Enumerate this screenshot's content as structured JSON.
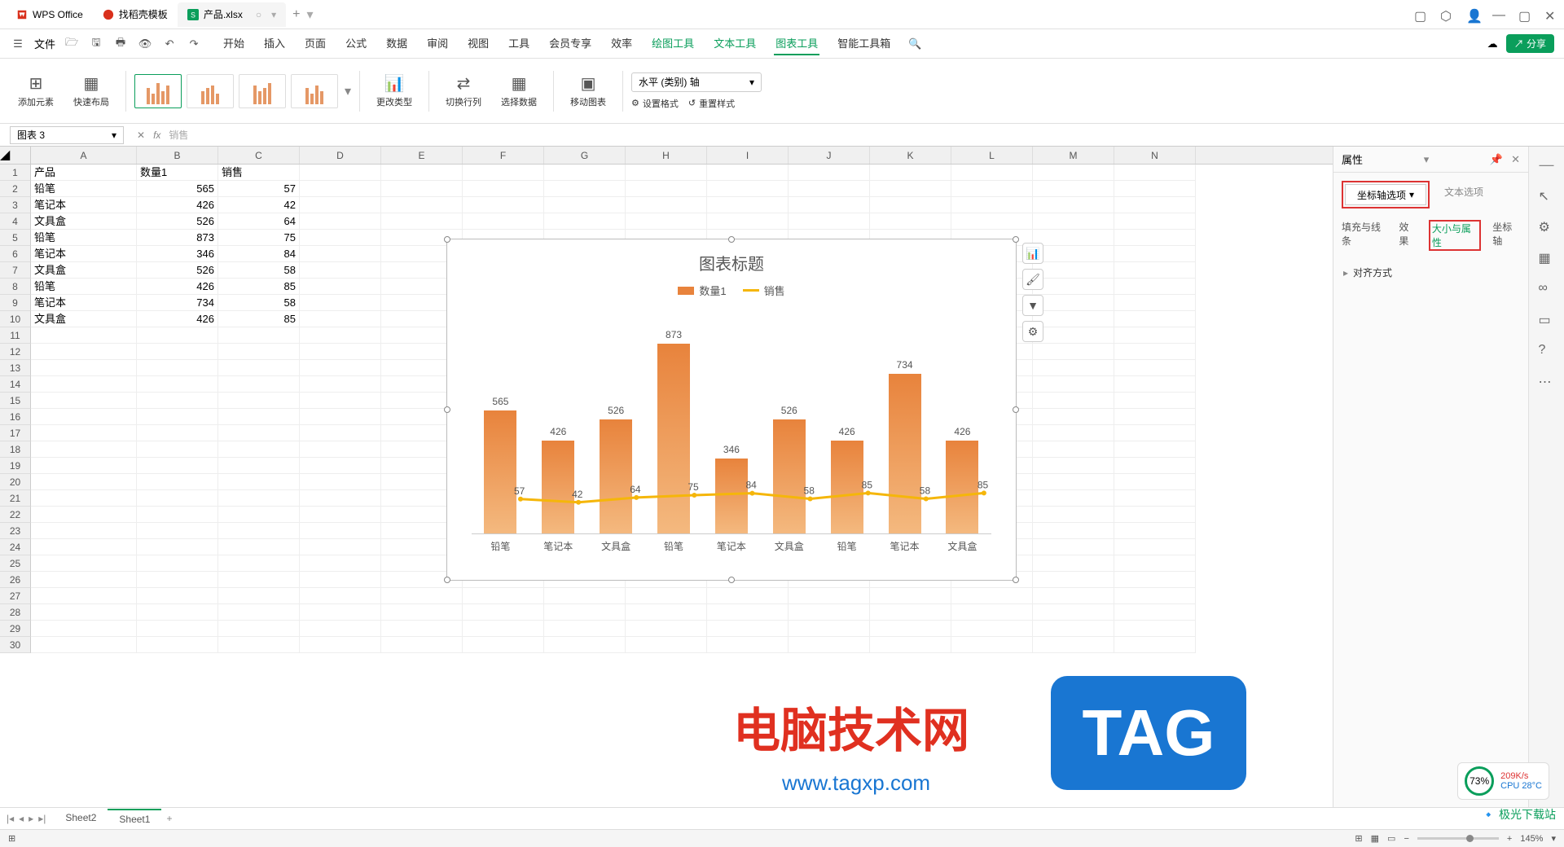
{
  "titlebar": {
    "tabs": [
      {
        "label": "WPS Office",
        "icon": "wps"
      },
      {
        "label": "找稻壳模板",
        "icon": "docer"
      },
      {
        "label": "产品.xlsx",
        "icon": "sheet",
        "active": true
      }
    ]
  },
  "menubar": {
    "file": "文件",
    "tabs": [
      "开始",
      "插入",
      "页面",
      "公式",
      "数据",
      "审阅",
      "视图",
      "工具",
      "会员专享",
      "效率",
      "绘图工具",
      "文本工具",
      "图表工具",
      "智能工具箱"
    ],
    "active": "图表工具",
    "green_tabs": [
      "绘图工具",
      "文本工具",
      "图表工具"
    ],
    "share": "分享"
  },
  "ribbon": {
    "add_element": "添加元素",
    "quick_layout": "快速布局",
    "change_type": "更改类型",
    "switch_rc": "切换行列",
    "select_data": "选择数据",
    "move_chart": "移动图表",
    "axis_dropdown": "水平 (类别) 轴",
    "set_format": "设置格式",
    "reset_style": "重置样式"
  },
  "formula": {
    "name_box": "图表 3",
    "value": "销售"
  },
  "columns": [
    "A",
    "B",
    "C",
    "D",
    "E",
    "F",
    "G",
    "H",
    "I",
    "J",
    "K",
    "L",
    "M",
    "N"
  ],
  "table": {
    "headers": [
      "产品",
      "数量1",
      "销售"
    ],
    "rows": [
      [
        "铅笔",
        565,
        57
      ],
      [
        "笔记本",
        426,
        42
      ],
      [
        "文具盒",
        526,
        64
      ],
      [
        "铅笔",
        873,
        75
      ],
      [
        "笔记本",
        346,
        84
      ],
      [
        "文具盒",
        526,
        58
      ],
      [
        "铅笔",
        426,
        85
      ],
      [
        "笔记本",
        734,
        58
      ],
      [
        "文具盒",
        426,
        85
      ]
    ]
  },
  "chart_data": {
    "type": "bar",
    "title": "图表标题",
    "series": [
      {
        "name": "数量1",
        "type": "bar",
        "values": [
          565,
          426,
          526,
          873,
          346,
          526,
          426,
          734,
          426
        ],
        "color": "#e8833c"
      },
      {
        "name": "销售",
        "type": "line",
        "values": [
          57,
          42,
          64,
          75,
          84,
          58,
          85,
          58,
          85
        ],
        "color": "#f5b60a"
      }
    ],
    "categories": [
      "铅笔",
      "笔记本",
      "文具盒",
      "铅笔",
      "笔记本",
      "文具盒",
      "铅笔",
      "笔记本",
      "文具盒"
    ],
    "ylim": [
      0,
      900
    ]
  },
  "panel": {
    "title": "属性",
    "dropdown": "坐标轴选项",
    "text_option": "文本选项",
    "subtabs": [
      "填充与线条",
      "效果",
      "大小与属性",
      "坐标轴"
    ],
    "active_subtab": "大小与属性",
    "section": "对齐方式"
  },
  "sheets": {
    "tabs": [
      "Sheet2",
      "Sheet1"
    ],
    "active": "Sheet1"
  },
  "status": {
    "zoom": "145%"
  },
  "watermarks": {
    "text1": "电脑技术网",
    "url1": "www.tagxp.com",
    "tag": "TAG",
    "dl": "极光下载站"
  },
  "perf": {
    "pct": "73%",
    "net": "209K/s",
    "cpu": "CPU 28°C"
  }
}
